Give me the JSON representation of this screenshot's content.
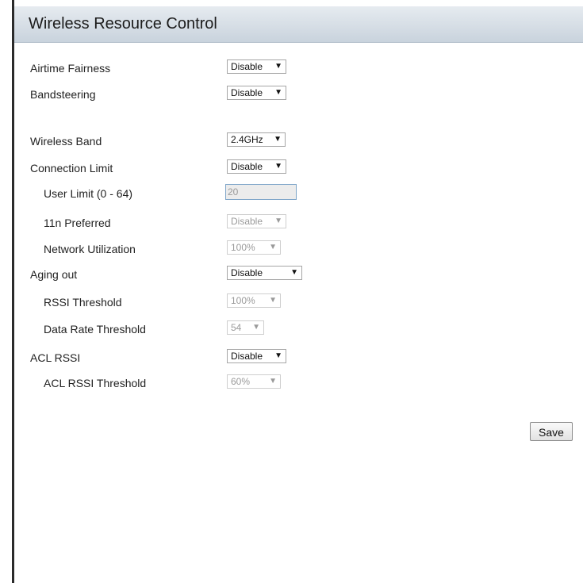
{
  "page": {
    "title": "Wireless Resource Control",
    "save_label": "Save"
  },
  "fields": {
    "airtime_fairness": {
      "label": "Airtime Fairness",
      "value": "Disable"
    },
    "bandsteering": {
      "label": "Bandsteering",
      "value": "Disable"
    },
    "wireless_band": {
      "label": "Wireless Band",
      "value": "2.4GHz"
    },
    "connection_limit": {
      "label": "Connection Limit",
      "value": "Disable"
    },
    "user_limit": {
      "label": "User Limit (0 - 64)",
      "value": "20"
    },
    "n11_preferred": {
      "label": "11n Preferred",
      "value": "Disable"
    },
    "network_utilization": {
      "label": "Network Utilization",
      "value": "100%"
    },
    "aging_out": {
      "label": "Aging out",
      "value": "Disable"
    },
    "rssi_threshold": {
      "label": "RSSI Threshold",
      "value": "100%"
    },
    "data_rate_threshold": {
      "label": "Data Rate Threshold",
      "value": "54"
    },
    "acl_rssi": {
      "label": "ACL RSSI",
      "value": "Disable"
    },
    "acl_rssi_threshold": {
      "label": "ACL RSSI Threshold",
      "value": "60%"
    }
  },
  "icons": {
    "dropdown_arrow": "▼"
  }
}
